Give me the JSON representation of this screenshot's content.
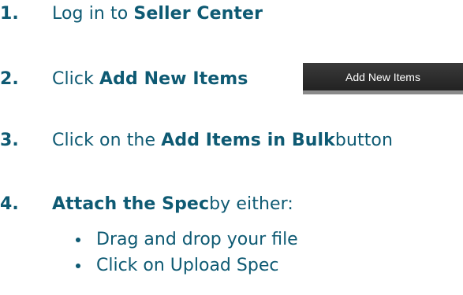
{
  "steps": [
    {
      "number": "1.",
      "pre": "Log in to ",
      "bold": "Seller Center",
      "post": ""
    },
    {
      "number": "2.",
      "pre": "Click ",
      "bold": "Add New Items",
      "post": ""
    },
    {
      "number": "3.",
      "pre": "Click on the ",
      "bold": "Add Items in Bulk",
      "post": " button"
    },
    {
      "number": "4.",
      "pre": "",
      "bold": "Attach the Spec",
      "post": " by either:"
    }
  ],
  "add_new_items_button": {
    "label": "Add New Items"
  },
  "bullets": [
    "Drag and drop your file",
    "Click on Upload Spec"
  ],
  "colors": {
    "text": "#0e5a73",
    "button_bg": "#2b2b2b",
    "button_text": "#ffffff"
  }
}
